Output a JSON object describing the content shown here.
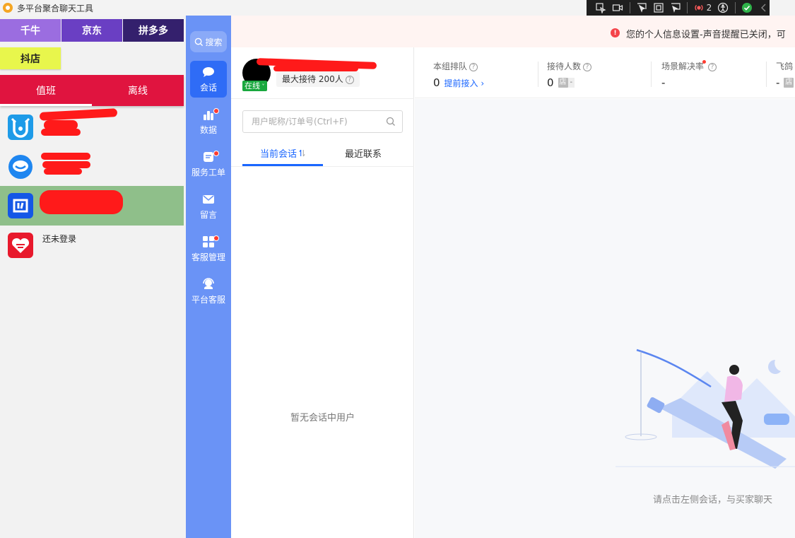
{
  "window": {
    "title": "多平台聚合聊天工具"
  },
  "debug_toolbar": {
    "live_count": "2"
  },
  "platforms": [
    {
      "label": "千牛"
    },
    {
      "label": "京东"
    },
    {
      "label": "拼多多"
    },
    {
      "label": "抖店"
    }
  ],
  "duty": {
    "on_label": "值班",
    "off_label": "离线"
  },
  "accounts": [
    {
      "name": "",
      "icon": "qianniu-icon",
      "color": "#1e9be8"
    },
    {
      "name": "",
      "icon": "jd-chat-icon",
      "color": "#1e86f0"
    },
    {
      "name": "",
      "icon": "doudian-icon",
      "color": "#1457e6"
    },
    {
      "name": "还未登录",
      "icon": "pdd-icon",
      "color": "#e8192c"
    }
  ],
  "nav": {
    "search_label": "搜索",
    "items": [
      {
        "label": "会话",
        "icon": "chat-bubble-icon"
      },
      {
        "label": "数据",
        "icon": "bar-chart-icon"
      },
      {
        "label": "服务工单",
        "icon": "ticket-icon"
      },
      {
        "label": "留言",
        "icon": "mail-icon"
      },
      {
        "label": "客服管理",
        "icon": "grid-apps-icon"
      },
      {
        "label": "平台客服",
        "icon": "headset-icon"
      }
    ]
  },
  "notice": {
    "text": "您的个人信息设置-声音提醒已关闭，可"
  },
  "profile": {
    "status": "在线",
    "max_reception": "最大接待 200人"
  },
  "session": {
    "search_placeholder": "用户昵称/订单号(Ctrl+F)",
    "tabs": [
      {
        "label": "当前会话"
      },
      {
        "label": "最近联系"
      }
    ],
    "empty_text": "暂无会话中用户"
  },
  "stats": [
    {
      "label": "本组排队",
      "value": "0",
      "link": "提前接入"
    },
    {
      "label": "接待人数",
      "value": "0",
      "shop_tag": "店",
      "shop_value": "-"
    },
    {
      "label": "场景解决率",
      "value": "-"
    },
    {
      "label": "飞鸽",
      "value": "-",
      "shop_tag": "店"
    }
  ],
  "chat": {
    "hint": "请点击左侧会话，与买家聊天"
  },
  "colors": {
    "accent": "#1a66ff",
    "rail": "#6a93f6",
    "duty": "#e0143f",
    "online": "#19a83e"
  }
}
